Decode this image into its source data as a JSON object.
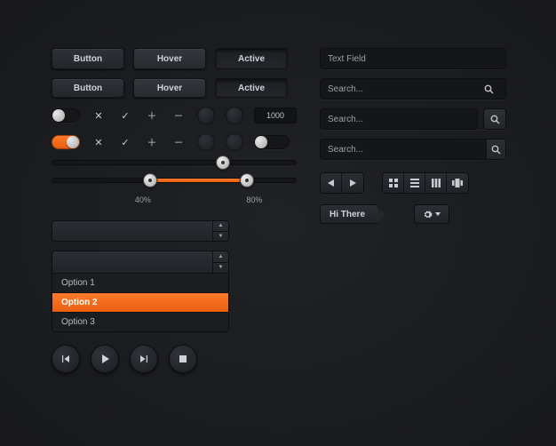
{
  "accent": "#f06a1a",
  "buttons_row1": {
    "b1": "Button",
    "b2": "Hover",
    "b3": "Active"
  },
  "buttons_row2": {
    "b1": "Button",
    "b2": "Hover",
    "b3": "Active"
  },
  "toggles": {
    "row1": {
      "state": "off"
    },
    "row2": {
      "state": "on"
    }
  },
  "numeric": {
    "value": "1000"
  },
  "slider1": {
    "value_pct": 70
  },
  "slider2": {
    "low_pct": 40,
    "high_pct": 80,
    "low_label": "40%",
    "high_label": "80%"
  },
  "text_field": {
    "placeholder": "Text Field"
  },
  "search1": {
    "placeholder": "Search..."
  },
  "search2": {
    "placeholder": "Search..."
  },
  "search3": {
    "placeholder": "Search..."
  },
  "tag": {
    "label": "Hi There"
  },
  "dropdown": {
    "options": [
      "Option 1",
      "Option 2",
      "Option 3"
    ],
    "opt0": "Option 1",
    "opt1": "Option 2",
    "opt2": "Option 3",
    "selected_index": 1
  },
  "icons": {
    "close": "close-icon",
    "check": "check-icon",
    "plus": "plus-icon",
    "minus": "minus-icon",
    "search": "search-icon",
    "prev": "prev-icon",
    "play": "play-icon",
    "next": "next-icon",
    "stop": "stop-icon",
    "grid": "grid-view-icon",
    "list": "list-view-icon",
    "columns": "columns-view-icon",
    "cover": "cover-view-icon",
    "gear": "gear-icon",
    "chev_down": "chevron-down-icon",
    "chev_up": "chevron-up-icon",
    "tri_left": "triangle-left-icon",
    "tri_right": "triangle-right-icon"
  }
}
